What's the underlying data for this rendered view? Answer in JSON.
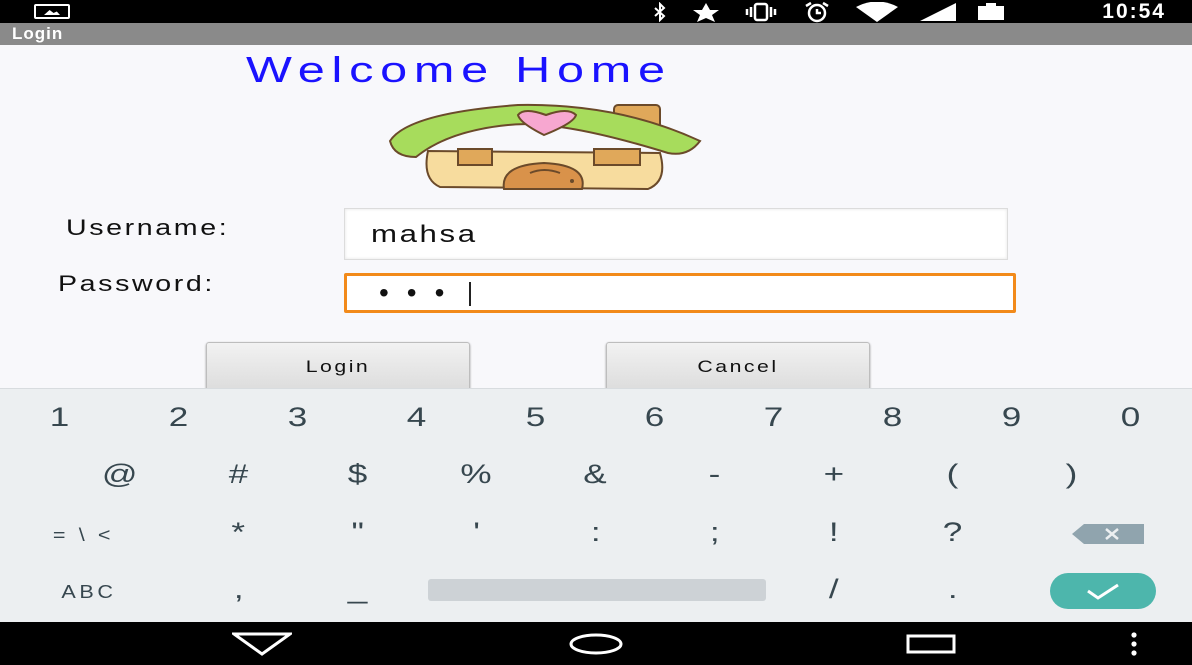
{
  "status_bar": {
    "time": "10:54",
    "icons": [
      "image-icon",
      "bluetooth-icon",
      "star-icon",
      "vibrate-icon",
      "alarm-icon",
      "wifi-icon",
      "cell-signal-icon",
      "battery-icon"
    ]
  },
  "action_bar": {
    "title": "Login"
  },
  "main": {
    "welcome": "Welcome Home",
    "username_label": "Username:",
    "username_value": "mahsa",
    "password_label": "Password:",
    "password_mask": "•••",
    "login_button": "Login",
    "cancel_button": "Cancel"
  },
  "keyboard": {
    "row1": [
      "1",
      "2",
      "3",
      "4",
      "5",
      "6",
      "7",
      "8",
      "9",
      "0"
    ],
    "row2": [
      "@",
      "#",
      "$",
      "%",
      "&",
      "-",
      "+",
      "(",
      ")"
    ],
    "row3": [
      "= \\ <",
      "*",
      "\"",
      "'",
      ":",
      ";",
      "!",
      "?"
    ],
    "row4": [
      "ABC",
      ",",
      "_",
      "/",
      "."
    ]
  },
  "nav_bar": {
    "icons": [
      "back-icon",
      "home-icon",
      "recents-icon",
      "menu-icon"
    ]
  },
  "colors": {
    "welcome_text": "#1a12ff",
    "focus_border": "#f28a1a",
    "enter_key": "#4db6ac",
    "keyboard_bg": "#eceff1"
  }
}
